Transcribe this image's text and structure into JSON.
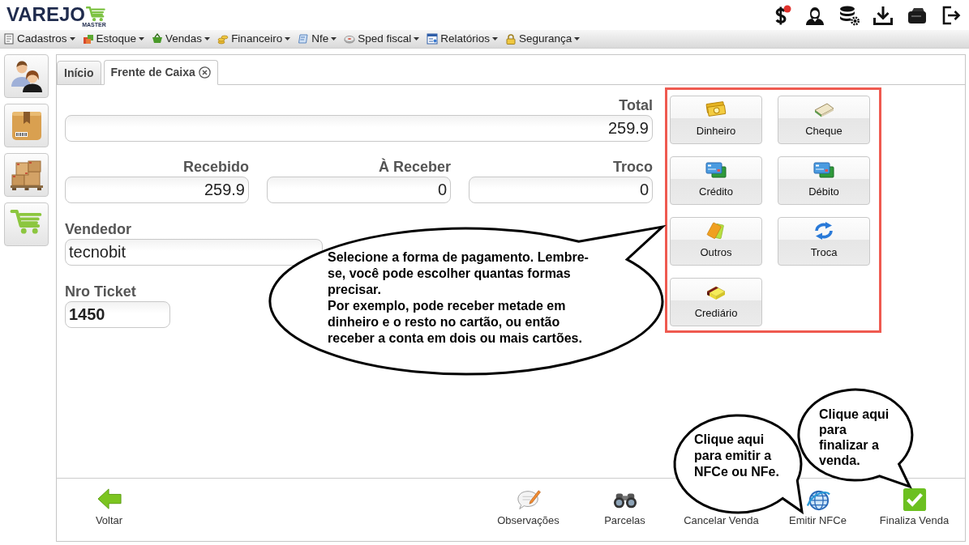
{
  "logo": {
    "name": "VAREJO",
    "tagline": "MASTER"
  },
  "menu": [
    {
      "label": "Cadastros"
    },
    {
      "label": "Estoque"
    },
    {
      "label": "Vendas"
    },
    {
      "label": "Financeiro"
    },
    {
      "label": "Nfe"
    },
    {
      "label": "Sped fiscal"
    },
    {
      "label": "Relatórios"
    },
    {
      "label": "Segurança"
    }
  ],
  "tabs": [
    {
      "label": "Início",
      "selected": false,
      "closable": false
    },
    {
      "label": "Frente de Caixa",
      "selected": true,
      "closable": true
    }
  ],
  "sale": {
    "total": {
      "label": "Total",
      "value": "259.9"
    },
    "amounts": [
      {
        "label": "Recebido",
        "value": "259.9"
      },
      {
        "label": "À Receber",
        "value": "0"
      },
      {
        "label": "Troco",
        "value": "0"
      }
    ],
    "seller": {
      "label": "Vendedor",
      "value": "tecnobit"
    },
    "ticket": {
      "label": "Nro Ticket",
      "value": "1450"
    }
  },
  "payment_methods": [
    {
      "label": "Dinheiro",
      "kind": "cash"
    },
    {
      "label": "Cheque",
      "kind": "cheque"
    },
    {
      "label": "Crédito",
      "kind": "card"
    },
    {
      "label": "Débito",
      "kind": "card"
    },
    {
      "label": "Outros",
      "kind": "tickets"
    },
    {
      "label": "Troca",
      "kind": "exchange"
    },
    {
      "label": "Crediário",
      "kind": "notepad"
    }
  ],
  "actions": [
    {
      "label": "Voltar",
      "kind": "back"
    },
    {
      "label": "Observações",
      "kind": "notes"
    },
    {
      "label": "Parcelas",
      "kind": "installments"
    },
    {
      "label": "Cancelar Venda",
      "kind": "cancel"
    },
    {
      "label": "Emitir NFCe",
      "kind": "invoice"
    },
    {
      "label": "Finaliza Venda",
      "kind": "finish"
    }
  ],
  "callouts": [
    {
      "paragraphs": [
        "Selecione a forma de pagamento. Lembre-se, você pode escolher quantas formas precisar.",
        "Por exemplo, pode receber metade em dinheiro e o resto no cartão, ou então receber a conta em dois ou mais cartões."
      ]
    },
    {
      "paragraphs": [
        "Clique aqui para emitir a NFCe ou NFe."
      ]
    },
    {
      "paragraphs": [
        "Clique aqui para finalizar a venda."
      ]
    }
  ]
}
